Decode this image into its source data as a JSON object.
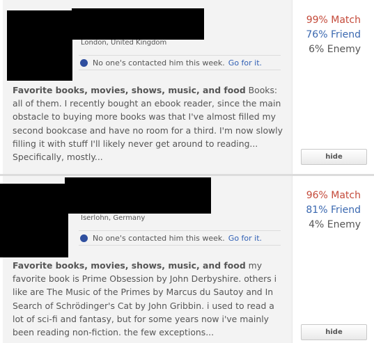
{
  "profiles": [
    {
      "location": "London, United Kingdom",
      "contact_status": "No one's contacted him this week.",
      "contact_link": "Go for it.",
      "essay_heading": "Favorite books, movies, shows, music, and food",
      "essay_text": " Books: all of them. I recently bought an ebook reader, since the main obstacle to buying more books was that I've almost filled my second bookcase and have no room for a third. I'm now slowly filling it with stuff I'll likely never get around to reading... Specifically, mostly...",
      "match": "99% Match",
      "friend": "76% Friend",
      "enemy": "6% Enemy",
      "hide_label": "hide"
    },
    {
      "location": "Iserlohn, Germany",
      "contact_status": "No one's contacted him this week.",
      "contact_link": "Go for it.",
      "essay_heading": "Favorite books, movies, shows, music, and food",
      "essay_text": " my favorite book is Prime Obsession by John Derbyshire. others i like are The Music of the Primes by Marcus du Sautoy and In Search of Schrödinger's Cat by John Gribbin. i used to read a lot of sci-fi and fantasy, but for some years now i've mainly been reading non-fiction. the few exceptions...",
      "match": "96% Match",
      "friend": "81% Friend",
      "enemy": "4% Enemy",
      "hide_label": "hide"
    }
  ],
  "colors": {
    "match": "#c44a3a",
    "friend": "#3a68b0",
    "contact_dot": "#2f4f9f",
    "link": "#2f5fb4"
  }
}
